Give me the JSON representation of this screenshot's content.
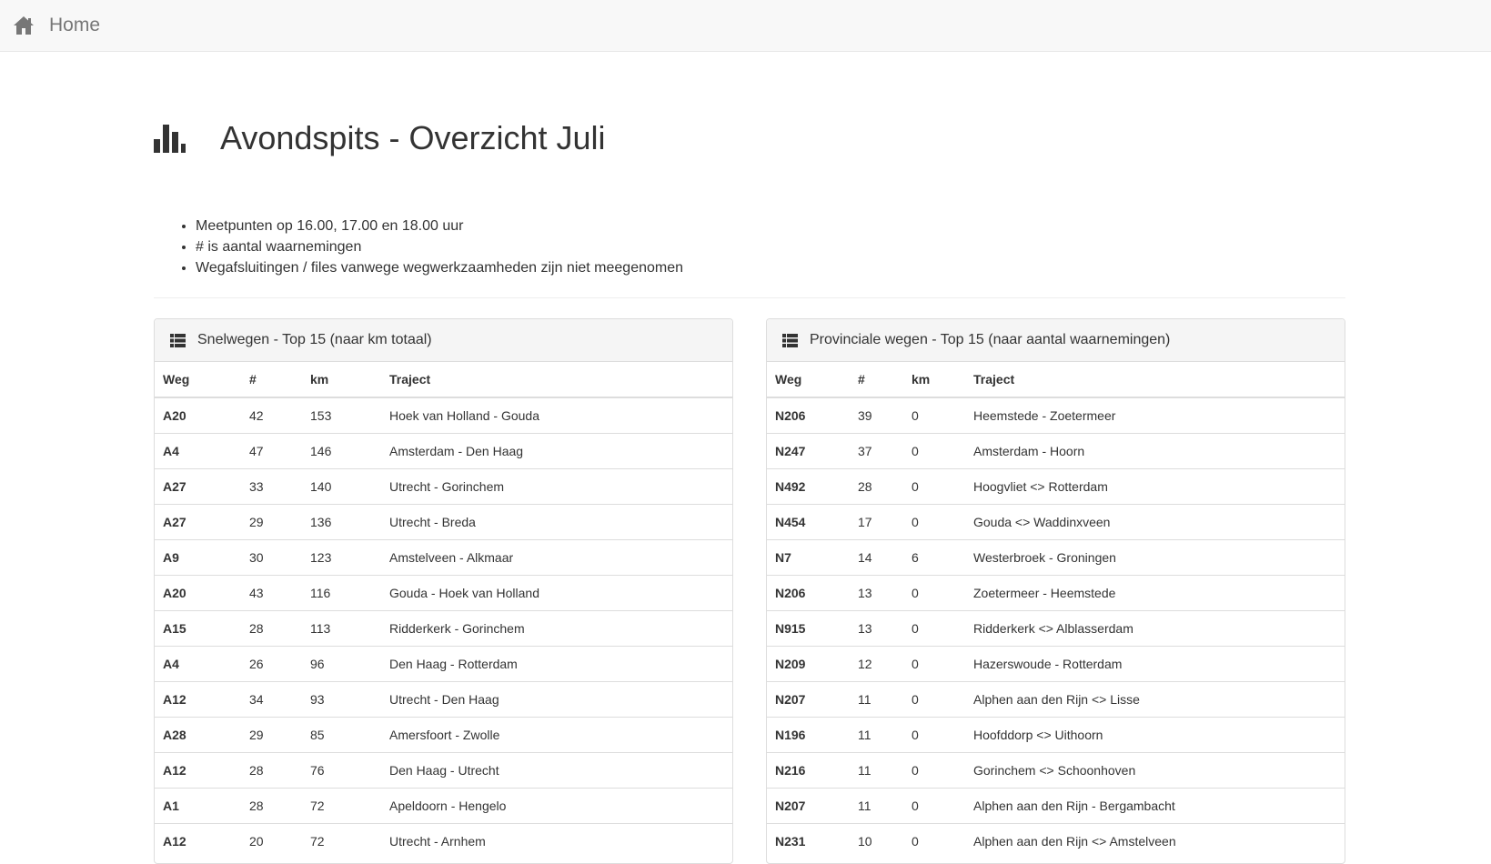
{
  "nav": {
    "brand_label": "Home",
    "brand_icon": "home-icon"
  },
  "page": {
    "title": "Avondspits - Overzicht Juli",
    "title_icon": "bar-chart-icon"
  },
  "notes": [
    "Meetpunten op 16.00, 17.00 en 18.00 uur",
    "# is aantal waarnemingen",
    "Wegafsluitingen / files vanwege wegwerkzaamheden zijn niet meegenomen"
  ],
  "columns": {
    "weg": "Weg",
    "count": "#",
    "km": "km",
    "traject": "Traject"
  },
  "snelwegen": {
    "title": "Snelwegen - Top 15 (naar km totaal)",
    "rows": [
      {
        "weg": "A20",
        "count": "42",
        "km": "153",
        "traject": "Hoek van Holland - Gouda"
      },
      {
        "weg": "A4",
        "count": "47",
        "km": "146",
        "traject": "Amsterdam - Den Haag"
      },
      {
        "weg": "A27",
        "count": "33",
        "km": "140",
        "traject": "Utrecht - Gorinchem"
      },
      {
        "weg": "A27",
        "count": "29",
        "km": "136",
        "traject": "Utrecht - Breda"
      },
      {
        "weg": "A9",
        "count": "30",
        "km": "123",
        "traject": "Amstelveen - Alkmaar"
      },
      {
        "weg": "A20",
        "count": "43",
        "km": "116",
        "traject": "Gouda - Hoek van Holland"
      },
      {
        "weg": "A15",
        "count": "28",
        "km": "113",
        "traject": "Ridderkerk - Gorinchem"
      },
      {
        "weg": "A4",
        "count": "26",
        "km": "96",
        "traject": "Den Haag - Rotterdam"
      },
      {
        "weg": "A12",
        "count": "34",
        "km": "93",
        "traject": "Utrecht - Den Haag"
      },
      {
        "weg": "A28",
        "count": "29",
        "km": "85",
        "traject": "Amersfoort - Zwolle"
      },
      {
        "weg": "A12",
        "count": "28",
        "km": "76",
        "traject": "Den Haag - Utrecht"
      },
      {
        "weg": "A1",
        "count": "28",
        "km": "72",
        "traject": "Apeldoorn - Hengelo"
      },
      {
        "weg": "A12",
        "count": "20",
        "km": "72",
        "traject": "Utrecht - Arnhem"
      }
    ]
  },
  "provinciale": {
    "title": "Provinciale wegen - Top 15 (naar aantal waarnemingen)",
    "rows": [
      {
        "weg": "N206",
        "count": "39",
        "km": "0",
        "traject": "Heemstede - Zoetermeer"
      },
      {
        "weg": "N247",
        "count": "37",
        "km": "0",
        "traject": "Amsterdam - Hoorn"
      },
      {
        "weg": "N492",
        "count": "28",
        "km": "0",
        "traject": "Hoogvliet <> Rotterdam"
      },
      {
        "weg": "N454",
        "count": "17",
        "km": "0",
        "traject": "Gouda <> Waddinxveen"
      },
      {
        "weg": "N7",
        "count": "14",
        "km": "6",
        "traject": "Westerbroek - Groningen"
      },
      {
        "weg": "N206",
        "count": "13",
        "km": "0",
        "traject": "Zoetermeer - Heemstede"
      },
      {
        "weg": "N915",
        "count": "13",
        "km": "0",
        "traject": "Ridderkerk <> Alblasserdam"
      },
      {
        "weg": "N209",
        "count": "12",
        "km": "0",
        "traject": "Hazerswoude - Rotterdam"
      },
      {
        "weg": "N207",
        "count": "11",
        "km": "0",
        "traject": "Alphen aan den Rijn <> Lisse"
      },
      {
        "weg": "N196",
        "count": "11",
        "km": "0",
        "traject": "Hoofddorp <> Uithoorn"
      },
      {
        "weg": "N216",
        "count": "11",
        "km": "0",
        "traject": "Gorinchem <> Schoonhoven"
      },
      {
        "weg": "N207",
        "count": "11",
        "km": "0",
        "traject": "Alphen aan den Rijn - Bergambacht"
      },
      {
        "weg": "N231",
        "count": "10",
        "km": "0",
        "traject": "Alphen aan den Rijn <> Amstelveen"
      }
    ]
  }
}
